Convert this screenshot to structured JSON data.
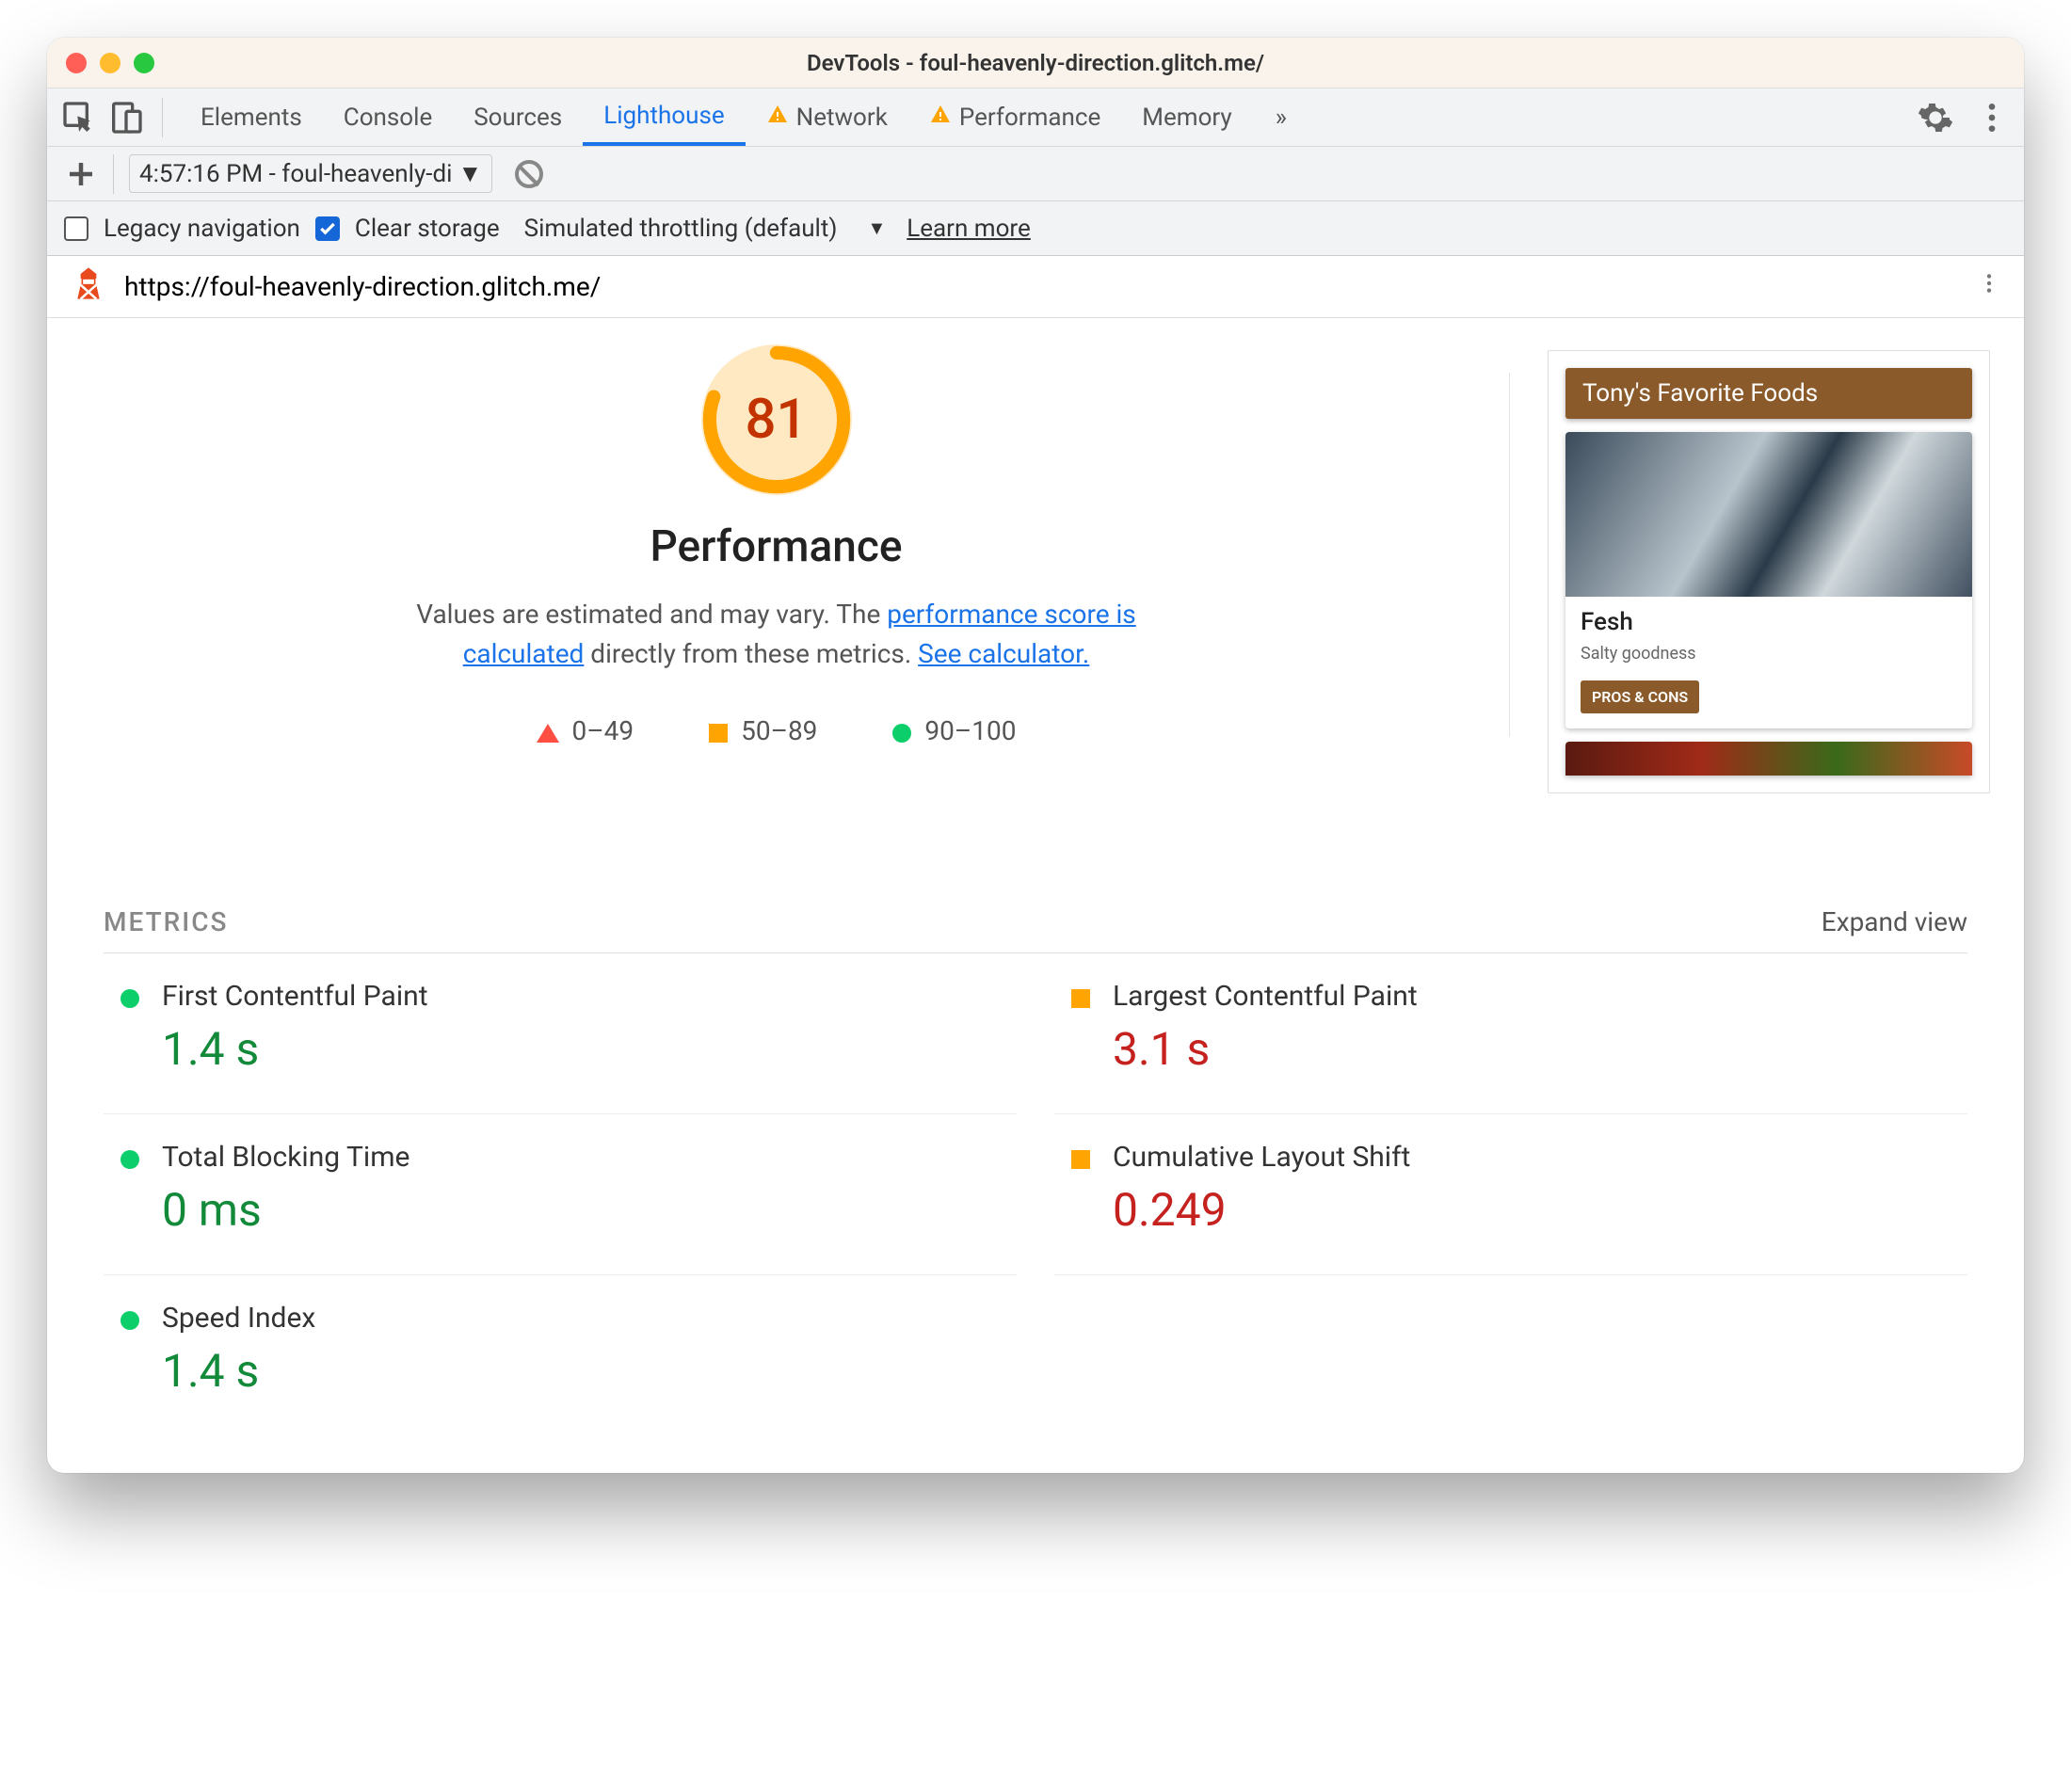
{
  "window": {
    "title": "DevTools - foul-heavenly-direction.glitch.me/"
  },
  "tabs": {
    "items": [
      "Elements",
      "Console",
      "Sources",
      "Lighthouse",
      "Network",
      "Performance",
      "Memory"
    ],
    "active": "Lighthouse",
    "warn": [
      "Network",
      "Performance"
    ]
  },
  "runbar": {
    "timestamp_label": "4:57:16 PM - foul-heavenly-di"
  },
  "options": {
    "legacy_label": "Legacy navigation",
    "legacy_checked": false,
    "clearstorage_label": "Clear storage",
    "clearstorage_checked": true,
    "throttling_label": "Simulated throttling (default)",
    "learn_more": "Learn more"
  },
  "urlbar": {
    "url": "https://foul-heavenly-direction.glitch.me/"
  },
  "gauge": {
    "score": "81",
    "title": "Performance"
  },
  "desc": {
    "pre": "Values are estimated and may vary. The ",
    "link1": "performance score is calculated",
    "mid": " directly from these metrics. ",
    "link2": "See calculator."
  },
  "legend": {
    "a": "0–49",
    "b": "50–89",
    "c": "90–100"
  },
  "preview": {
    "header": "Tony's Favorite Foods",
    "card_title": "Fesh",
    "card_sub": "Salty goodness",
    "card_btn": "PROS & CONS"
  },
  "metrics": {
    "heading": "METRICS",
    "expand": "Expand view",
    "items": [
      {
        "name": "First Contentful Paint",
        "value": "1.4 s",
        "status": "green"
      },
      {
        "name": "Largest Contentful Paint",
        "value": "3.1 s",
        "status": "orange",
        "valcolor": "red"
      },
      {
        "name": "Total Blocking Time",
        "value": "0 ms",
        "status": "green"
      },
      {
        "name": "Cumulative Layout Shift",
        "value": "0.249",
        "status": "orange",
        "valcolor": "red"
      },
      {
        "name": "Speed Index",
        "value": "1.4 s",
        "status": "green"
      }
    ]
  }
}
